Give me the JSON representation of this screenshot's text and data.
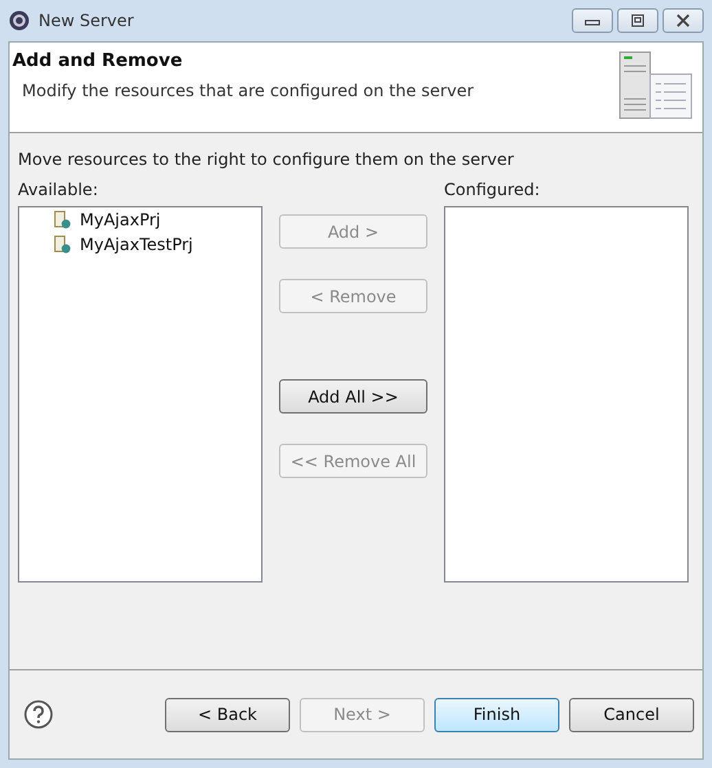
{
  "window": {
    "title": "New Server"
  },
  "header": {
    "title": "Add and Remove",
    "description": "Modify the resources that are configured on the server"
  },
  "instruction": "Move resources to the right to configure them on the server",
  "available": {
    "label": "Available:",
    "items": [
      {
        "label": "MyAjaxPrj"
      },
      {
        "label": "MyAjaxTestPrj"
      }
    ]
  },
  "move_buttons": [
    {
      "label": "Add >",
      "disabled": true
    },
    {
      "label": "< Remove",
      "disabled": true
    },
    {
      "label": "Add All >>",
      "disabled": false
    },
    {
      "label": "<< Remove All",
      "disabled": true
    }
  ],
  "configured": {
    "label": "Configured:"
  },
  "footer_buttons": [
    {
      "label": "< Back",
      "disabled": false,
      "default": false
    },
    {
      "label": "Next >",
      "disabled": true,
      "default": false
    },
    {
      "label": "Finish",
      "disabled": false,
      "default": true
    },
    {
      "label": "Cancel",
      "disabled": false,
      "default": false
    }
  ]
}
